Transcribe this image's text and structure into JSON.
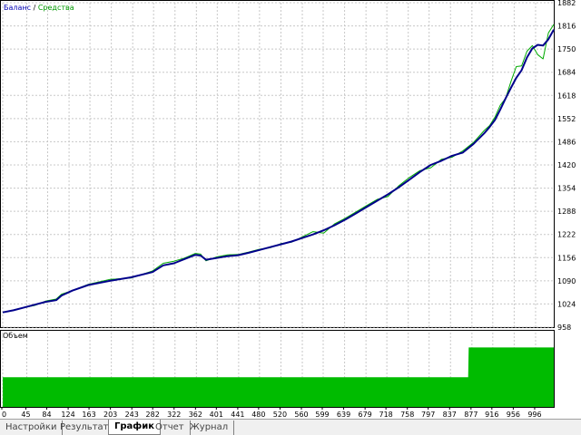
{
  "legend": {
    "balance_label": "Баланс",
    "separator": " / ",
    "equity_label": "Средства"
  },
  "volume_title": "Объем",
  "tabs": [
    {
      "label": "Настройки",
      "active": false
    },
    {
      "label": "Результаты",
      "active": false
    },
    {
      "label": "График",
      "active": true
    },
    {
      "label": "Отчет",
      "active": false
    },
    {
      "label": "Журнал",
      "active": false
    }
  ],
  "colors": {
    "balance": "#00008b",
    "equity": "#00aa00",
    "volume": "#00bb00",
    "grid": "#c8c8c8"
  },
  "chart_data": [
    {
      "type": "line",
      "title": "",
      "ylim": [
        958,
        1882
      ],
      "yticks": [
        958,
        1024,
        1090,
        1156,
        1222,
        1288,
        1354,
        1420,
        1486,
        1552,
        1618,
        1684,
        1750,
        1816,
        1882
      ],
      "xlim": [
        0,
        1030
      ],
      "xticks": [
        0,
        45,
        84,
        124,
        163,
        203,
        243,
        282,
        322,
        362,
        401,
        441,
        480,
        520,
        560,
        599,
        639,
        679,
        718,
        758,
        797,
        837,
        877,
        916,
        956,
        996
      ],
      "grid": true,
      "legend_position": "top-left",
      "series": [
        {
          "name": "Баланс",
          "x": [
            0,
            20,
            40,
            60,
            80,
            100,
            110,
            130,
            160,
            200,
            240,
            280,
            300,
            320,
            340,
            360,
            370,
            380,
            400,
            420,
            440,
            460,
            480,
            500,
            520,
            540,
            560,
            580,
            600,
            620,
            640,
            660,
            680,
            700,
            720,
            740,
            760,
            780,
            800,
            820,
            840,
            860,
            880,
            900,
            910,
            920,
            930,
            940,
            950,
            960,
            970,
            980,
            990,
            1000,
            1010,
            1020,
            1030
          ],
          "y": [
            1000,
            1006,
            1014,
            1022,
            1030,
            1035,
            1048,
            1062,
            1078,
            1090,
            1100,
            1115,
            1134,
            1140,
            1152,
            1164,
            1162,
            1150,
            1155,
            1160,
            1163,
            1170,
            1178,
            1186,
            1194,
            1202,
            1212,
            1222,
            1234,
            1248,
            1264,
            1282,
            1300,
            1318,
            1336,
            1356,
            1378,
            1400,
            1420,
            1432,
            1446,
            1455,
            1480,
            1510,
            1528,
            1548,
            1578,
            1610,
            1640,
            1668,
            1690,
            1726,
            1752,
            1762,
            1760,
            1778,
            1805
          ]
        },
        {
          "name": "Средства",
          "x": [
            0,
            20,
            40,
            60,
            80,
            100,
            110,
            130,
            160,
            200,
            240,
            280,
            300,
            320,
            340,
            360,
            370,
            380,
            400,
            420,
            440,
            460,
            480,
            500,
            520,
            540,
            560,
            580,
            600,
            620,
            640,
            660,
            680,
            700,
            720,
            740,
            760,
            780,
            800,
            820,
            840,
            860,
            880,
            900,
            910,
            920,
            930,
            940,
            950,
            960,
            970,
            980,
            990,
            1000,
            1010,
            1020,
            1030
          ],
          "y": [
            1000,
            1006,
            1014,
            1020,
            1032,
            1038,
            1052,
            1062,
            1080,
            1094,
            1098,
            1118,
            1140,
            1146,
            1155,
            1168,
            1166,
            1147,
            1158,
            1164,
            1165,
            1172,
            1180,
            1184,
            1196,
            1200,
            1215,
            1230,
            1226,
            1252,
            1268,
            1286,
            1304,
            1322,
            1330,
            1360,
            1384,
            1404,
            1412,
            1436,
            1442,
            1460,
            1484,
            1518,
            1532,
            1556,
            1590,
            1610,
            1658,
            1700,
            1702,
            1744,
            1760,
            1734,
            1722,
            1796,
            1820
          ]
        }
      ]
    },
    {
      "type": "area",
      "title": "Объем",
      "xlim": [
        0,
        1030
      ],
      "ylim": [
        0,
        2.5
      ],
      "series": [
        {
          "name": "Объем",
          "x": [
            0,
            870,
            871,
            1030
          ],
          "y": [
            1,
            1,
            2,
            2
          ]
        }
      ]
    }
  ]
}
